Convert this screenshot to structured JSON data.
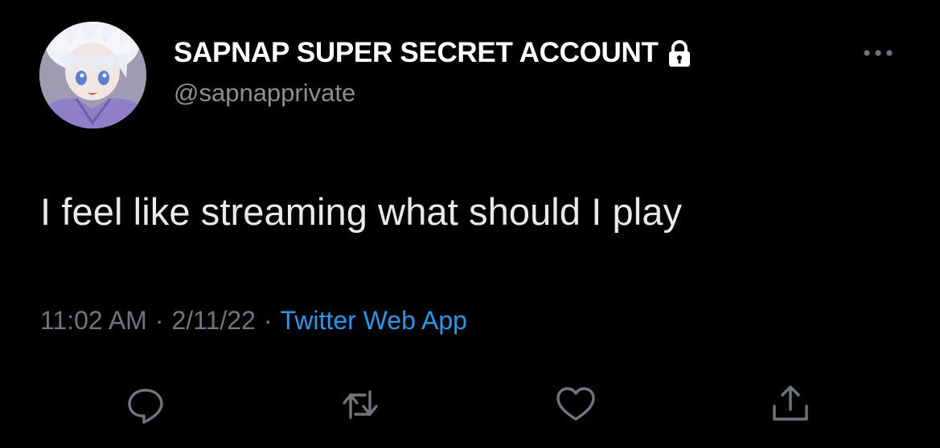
{
  "tweet": {
    "author": {
      "display_name": "SAPNAP SUPER SECRET ACCOUNT",
      "handle": "@sapnapprivate",
      "protected_icon": "lock-icon"
    },
    "text": "I feel like streaming what should I play",
    "meta": {
      "time": "11:02 AM",
      "separator": "·",
      "date": "2/11/22",
      "source": "Twitter Web App"
    },
    "actions": [
      {
        "name": "reply",
        "icon": "speech-bubble-icon"
      },
      {
        "name": "retweet",
        "icon": "retweet-arrows-icon"
      },
      {
        "name": "like",
        "icon": "heart-icon"
      },
      {
        "name": "share",
        "icon": "share-upload-icon"
      }
    ],
    "more_icon": "ellipsis-icon"
  },
  "colors": {
    "background": "#000000",
    "primary_text": "#e7e9ea",
    "secondary_text": "#6e767d",
    "link": "#1d9bf0",
    "icon": "#6e767d"
  }
}
